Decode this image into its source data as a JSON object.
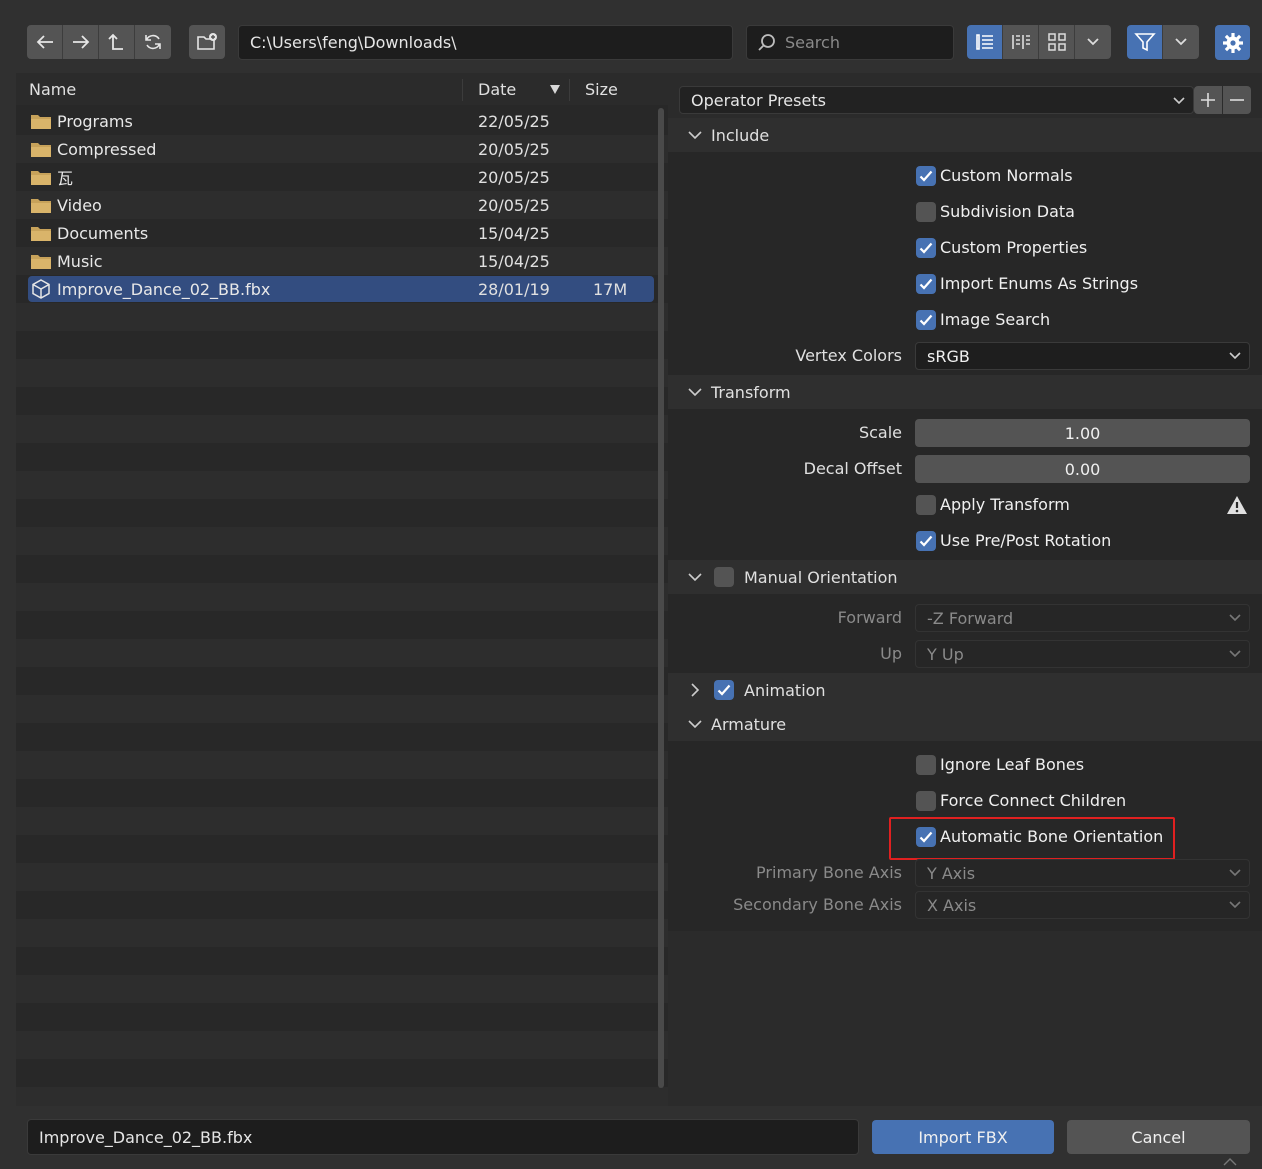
{
  "toolbar": {
    "path": "C:\\Users\\feng\\Downloads\\",
    "search_placeholder": "Search",
    "nav_icons": [
      "arrow-left-icon",
      "arrow-right-icon",
      "parent-dir-icon",
      "refresh-icon"
    ],
    "accent": "#4772b3"
  },
  "filelist": {
    "columns": {
      "name": "Name",
      "date": "Date",
      "size": "Size"
    },
    "items": [
      {
        "name": "Programs",
        "date": "22/05/25",
        "size": "",
        "type": "folder"
      },
      {
        "name": "Compressed",
        "date": "20/05/25",
        "size": "",
        "type": "folder"
      },
      {
        "name": "瓦",
        "date": "20/05/25",
        "size": "",
        "type": "folder"
      },
      {
        "name": "Video",
        "date": "20/05/25",
        "size": "",
        "type": "folder"
      },
      {
        "name": "Documents",
        "date": "15/04/25",
        "size": "",
        "type": "folder"
      },
      {
        "name": "Music",
        "date": "15/04/25",
        "size": "",
        "type": "folder"
      },
      {
        "name": "Improve_Dance_02_BB.fbx",
        "date": "28/01/19",
        "size": "17M",
        "type": "file"
      }
    ]
  },
  "panel": {
    "presets_label": "Operator Presets",
    "include": {
      "title": "Include",
      "options": [
        {
          "label": "Custom Normals",
          "checked": true
        },
        {
          "label": "Subdivision Data",
          "checked": false
        },
        {
          "label": "Custom Properties",
          "checked": true
        },
        {
          "label": "Import Enums As Strings",
          "checked": true
        },
        {
          "label": "Image Search",
          "checked": true
        }
      ],
      "vertex_colors_label": "Vertex Colors",
      "vertex_colors_value": "sRGB"
    },
    "transform": {
      "title": "Transform",
      "scale_label": "Scale",
      "scale_value": "1.00",
      "decal_label": "Decal Offset",
      "decal_value": "0.00",
      "apply_transform": {
        "label": "Apply Transform",
        "checked": false
      },
      "pre_post_rotation": {
        "label": "Use Pre/Post Rotation",
        "checked": true
      }
    },
    "manual_orientation": {
      "title": "Manual Orientation",
      "checked": false,
      "forward_label": "Forward",
      "forward_value": "-Z Forward",
      "up_label": "Up",
      "up_value": "Y Up"
    },
    "animation": {
      "title": "Animation",
      "checked": true
    },
    "armature": {
      "title": "Armature",
      "options": [
        {
          "label": "Ignore Leaf Bones",
          "checked": false
        },
        {
          "label": "Force Connect Children",
          "checked": false
        },
        {
          "label": "Automatic Bone Orientation",
          "checked": true
        }
      ],
      "primary_label": "Primary Bone Axis",
      "primary_value": "Y Axis",
      "secondary_label": "Secondary Bone Axis",
      "secondary_value": "X Axis"
    }
  },
  "footer": {
    "filename": "Improve_Dance_02_BB.fbx",
    "import_label": "Import FBX",
    "cancel_label": "Cancel"
  },
  "highlight_color": "#e02020"
}
